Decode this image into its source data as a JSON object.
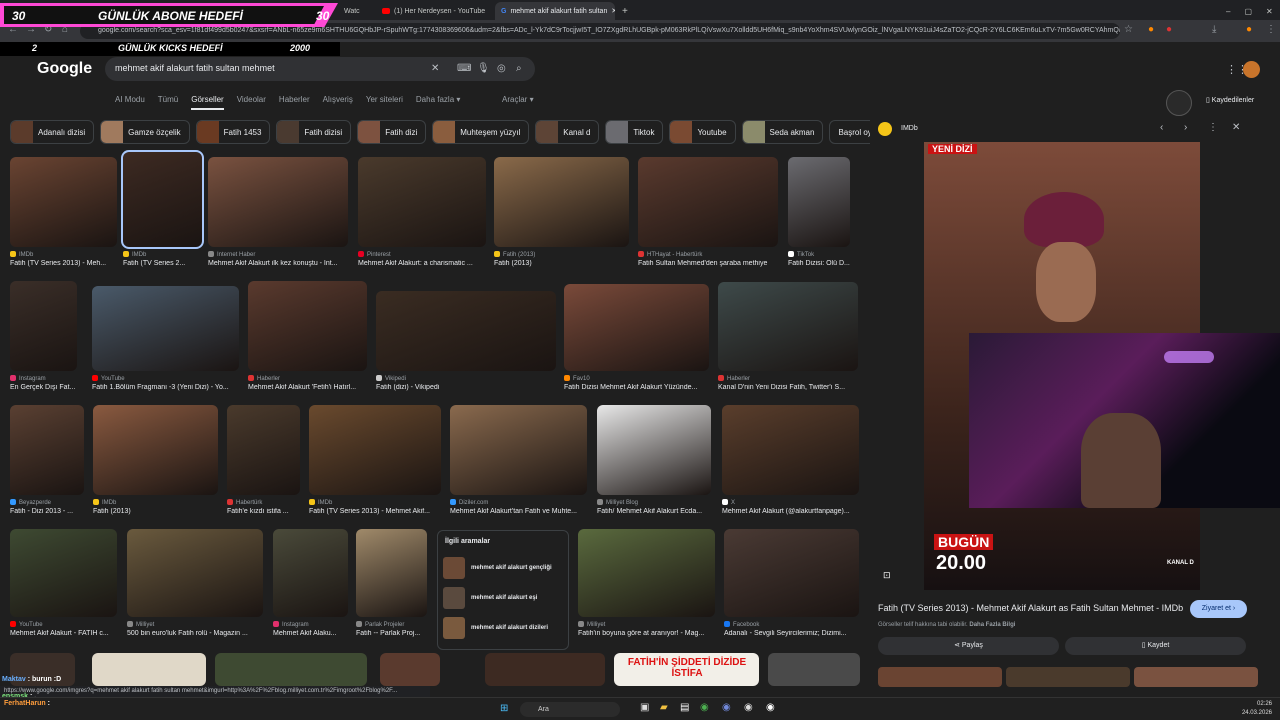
{
  "browser": {
    "tabs": [
      "Watc",
      "(1) Her Nerdeysen - YouTube",
      "mehmet akif alakurt fatih sultan"
    ],
    "url": "google.com/search?sca_esv=1f81df499d5b0247&sxsrf=ANbL-n65ze9m6SHTHU6GQHbJP-rSpuhWTg:1774308369606&udm=2&fbs=ADc_l-Yk7dC9rTocjjwI5T_IO7ZXgdRLhUGBpk-pM063RkPlLQiVswXu7Xolldd5UH6fMiq_s9nb4YoXhm4SVUwlynGOiz_lNVgaLNYK91uiJ4sZaTO2-jCQcR-2Y6LC6KEm6uLxTV-7m5Gw0RCYAhmQMgSaxV..."
  },
  "overlay": {
    "goal_label": "GÜNLÜK ABONE HEDEFİ",
    "goal_current": "30",
    "goal_target": "30",
    "kicks_label": "GÜNLÜK KICKS HEDEFİ",
    "kicks_current": "2",
    "kicks_target": "2000"
  },
  "google": {
    "logo": "Google",
    "query": "mehmet akif alakurt fatih sultan mehmet",
    "nav": [
      "AI Modu",
      "Tümü",
      "Görseller",
      "Videolar",
      "Haberler",
      "Alışveriş",
      "Yer siteleri",
      "Daha fazla ▾"
    ],
    "tools": "Araçlar ▾",
    "saved": "Kaydedilenler",
    "chips": [
      "Adanalı dizisi",
      "Gamze özçelik",
      "Fatih 1453",
      "Fatih dizisi",
      "Fatih dizi",
      "Muhteşem yüzyıl",
      "Kanal d",
      "Tiktok",
      "Youtube",
      "Seda akman",
      "Başrol oyuncusu"
    ]
  },
  "results": [
    {
      "src": "IMDb",
      "cap": "Fatih (TV Series 2013) - Meh...",
      "color": "#f5c518"
    },
    {
      "src": "IMDb",
      "cap": "Fatih (TV Series 2...",
      "color": "#f5c518"
    },
    {
      "src": "Internet Haber",
      "cap": "Mehmet Akif Alakurt ilk kez konuştu - Int...",
      "color": "#888"
    },
    {
      "src": "Pinterest",
      "cap": "Mehmet Akif Alakurt: a charismatic ...",
      "color": "#e60023"
    },
    {
      "src": "Fatih (2013)",
      "cap": "Fatih (2013)",
      "color": "#f5c518"
    },
    {
      "src": "HTHayat - Habertürk",
      "cap": "Fatih Sultan Mehmed'den şaraba methiye",
      "color": "#d33"
    },
    {
      "src": "TikTok",
      "cap": "Fatih Dizisi: Ölü D...",
      "color": "#fff"
    },
    {
      "src": "Instagram",
      "cap": "En Gerçek Dışı Fat...",
      "color": "#e1306c"
    },
    {
      "src": "YouTube",
      "cap": "Fatih 1.Bölüm Fragmanı -3 (Yeni Dizi) - Yo...",
      "color": "#f00"
    },
    {
      "src": "Haberler",
      "cap": "Mehmet Akif Alakurt 'Fetih'i Hatırl...",
      "color": "#d33"
    },
    {
      "src": "Vikipedi",
      "cap": "Fatih (dizi) - Vikipedi",
      "color": "#ccc"
    },
    {
      "src": "Fav10",
      "cap": "Fatih Dizisi Mehmet Akif Alakurt Yüzünde...",
      "color": "#f80"
    },
    {
      "src": "Haberler",
      "cap": "Kanal D'nin Yeni Dizisi Fatih, Twitter'ı S...",
      "color": "#d33"
    },
    {
      "src": "Beyazperde",
      "cap": "Fatih - Dizi 2013 - ...",
      "color": "#39f"
    },
    {
      "src": "IMDb",
      "cap": "Fatih (2013)",
      "color": "#f5c518"
    },
    {
      "src": "Habertürk",
      "cap": "Fatih'e kızdı istifa ...",
      "color": "#d33"
    },
    {
      "src": "IMDb",
      "cap": "Fatih (TV Series 2013) - Mehmet Akif...",
      "color": "#f5c518"
    },
    {
      "src": "Diziler.com",
      "cap": "Mehmet Akif Alakurt'tan Fatih ve Muhte...",
      "color": "#39f"
    },
    {
      "src": "Milliyet Blog",
      "cap": "Fatih/ Mehmet Akif Alakurt Ecda...",
      "color": "#888"
    },
    {
      "src": "X",
      "cap": "Mehmet Akif Alakurt (@alakurtfanpage)...",
      "color": "#fff"
    },
    {
      "src": "YouTube",
      "cap": "Mehmet Akif Alakurt - FATİH c...",
      "color": "#f00"
    },
    {
      "src": "Milliyet",
      "cap": "500 bin euro'luk Fatih rolü - Magazin ...",
      "color": "#888"
    },
    {
      "src": "Instagram",
      "cap": "Mehmet Akif Alaku...",
      "color": "#e1306c"
    },
    {
      "src": "Parlak Projeler",
      "cap": "Fatih -- Parlak Proj...",
      "color": "#888"
    },
    {
      "src": "Milliyet",
      "cap": "Fatih'in boyuna göre at aranıyor! - Mag...",
      "color": "#888"
    },
    {
      "src": "Facebook",
      "cap": "Adanalı - Sevgili Seyircilerimiz; Dizimi...",
      "color": "#1877f2"
    }
  ],
  "related": {
    "heading": "İlgili aramalar",
    "items": [
      "mehmet akif alakurt gençliği",
      "mehmet akif alakurt eşi",
      "mehmet akif alakurt dizileri"
    ]
  },
  "panel": {
    "source": "IMDb",
    "title": "Fatih (TV Series 2013) - Mehmet Akif Alakurt as Fatih Sultan Mehmet - IMDb",
    "visit": "Ziyaret et ›",
    "note": "Görseller telif hakkına tabi olabilir.",
    "note_link": "Daha Fazla Bilgi",
    "share": "Paylaş",
    "save": "Kaydet",
    "img_badge": "YENİ DİZİ",
    "img_today": "BUGÜN",
    "img_time": "20.00",
    "img_channel": "KANAL D"
  },
  "late_banner": "FATİH'İN ŞİDDETİ DİZİDE İSTİFA",
  "statusbar": "https://www.google.com/imgres?q=mehmet akif alakurt fatih sultan mehmet&imgurl=http%3A%2F%2Fblog.milliyet.com.tr%2Fimgroot%2Fblog%2F...",
  "chat": [
    {
      "user": "Maktav",
      "msg": ": burun :D"
    },
    {
      "user": "ensmsk",
      "msg": ": ."
    },
    {
      "user": "FerhatHarun",
      "msg": ":"
    }
  ],
  "taskbar": {
    "search": "Ara",
    "time": "02:26",
    "date": "24.03.2026"
  }
}
